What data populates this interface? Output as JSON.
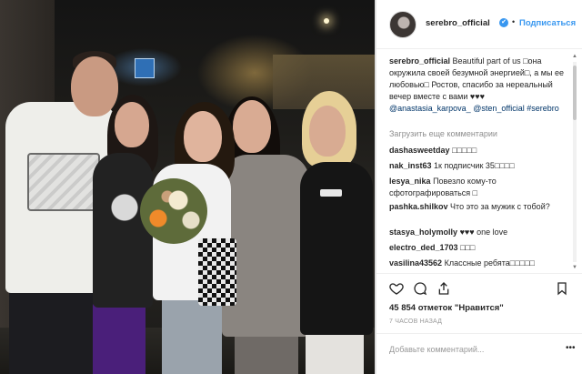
{
  "post": {
    "username": "serebro_official",
    "verified_mark": "✔",
    "separator": "•",
    "follow_label": "Подписаться",
    "caption": {
      "username": "serebro_official",
      "text": "Beautiful part of us □она окружила своей безумной энергией□, а мы ее любовью□ Ростов, спасибо за нереальный вечер вместе с вами ♥♥♥",
      "mention1": "@anastasia_karpova_",
      "mention2": "@sten_official",
      "hashtag": "#serebro"
    },
    "load_more": "Загрузить еще комментарии",
    "comments": [
      {
        "user": "dashasweetday",
        "text": "□□□□□"
      },
      {
        "user": "nak_inst63",
        "text": "1к подписчик 35□□□□"
      },
      {
        "user": "lesya_nika",
        "text": "Повезло кому-то сфотографироваться □"
      },
      {
        "user": "pashka.shilkov",
        "text": "Что это за мужик с тобой?"
      },
      {
        "user": "stasya_holymolly",
        "text": "♥♥♥ one love"
      },
      {
        "user": "electro_ded_1703",
        "text": "□□□"
      },
      {
        "user": "vasilina43562",
        "text": "Классные ребята□□□□□"
      }
    ],
    "likes": "45 854 отметок \"Нравится\"",
    "time": "7 ЧАСОВ НАЗАД",
    "add_comment_placeholder": "Добавьте комментарий...",
    "more_options": "•••"
  },
  "icons": [
    "heart-icon",
    "comment-icon",
    "share-icon",
    "bookmark-icon",
    "verified-badge-icon",
    "scroll-up-icon",
    "scroll-down-icon"
  ],
  "colors": {
    "accent": "#3897f0",
    "text": "#262626",
    "muted": "#8e8e8e",
    "link": "#003569"
  }
}
